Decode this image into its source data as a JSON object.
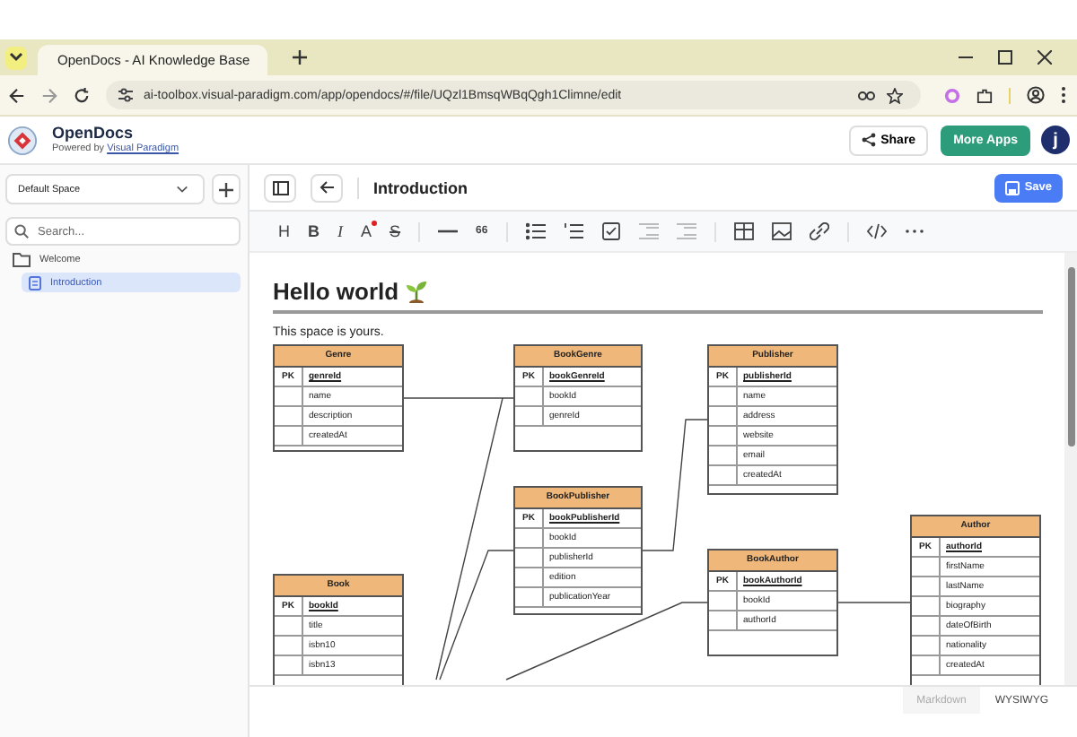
{
  "browser": {
    "tab_title": "OpenDocs - AI Knowledge Base",
    "url": "ai-toolbox.visual-paradigm.com/app/opendocs/#/file/UQzl1BmsqWBqQgh1Climne/edit"
  },
  "app": {
    "name": "OpenDocs",
    "powered_by": "Powered by",
    "powered_link": "Visual Paradigm",
    "share": "Share",
    "more_apps": "More Apps",
    "avatar": "j"
  },
  "sidebar": {
    "space": "Default Space",
    "search_placeholder": "Search...",
    "tree": [
      {
        "label": "Welcome",
        "selected": false,
        "children": [
          {
            "label": "Introduction",
            "selected": true
          }
        ]
      }
    ]
  },
  "editor": {
    "title": "Introduction",
    "save": "Save",
    "toolbar": [
      {
        "kind": "heading",
        "label": "H"
      },
      {
        "kind": "bold",
        "label": "B"
      },
      {
        "kind": "italic",
        "label": "I"
      },
      {
        "kind": "color",
        "label": "A"
      },
      {
        "kind": "strike",
        "label": "S"
      },
      {
        "kind": "divider"
      },
      {
        "kind": "rule"
      },
      {
        "kind": "quote",
        "label": "66"
      },
      {
        "kind": "divider"
      },
      {
        "kind": "bullets"
      },
      {
        "kind": "numbers"
      },
      {
        "kind": "task"
      },
      {
        "kind": "outdent"
      },
      {
        "kind": "indent"
      },
      {
        "kind": "divider"
      },
      {
        "kind": "table"
      },
      {
        "kind": "image"
      },
      {
        "kind": "link"
      },
      {
        "kind": "divider"
      },
      {
        "kind": "code"
      },
      {
        "kind": "more"
      }
    ],
    "heading": "Hello world",
    "paragraph": "This space is yours.",
    "entities": [
      {
        "name": "Genre",
        "fields": [
          {
            "key": "PK",
            "name": "genreId"
          },
          {
            "name": "name"
          },
          {
            "name": "description"
          },
          {
            "name": "createdAt"
          }
        ]
      },
      {
        "name": "BookGenre",
        "fields": [
          {
            "key": "PK",
            "name": "bookGenreId"
          },
          {
            "name": "bookId"
          },
          {
            "name": "genreId"
          }
        ]
      },
      {
        "name": "Publisher",
        "fields": [
          {
            "key": "PK",
            "name": "publisherId"
          },
          {
            "name": "name"
          },
          {
            "name": "address"
          },
          {
            "name": "website"
          },
          {
            "name": "email"
          },
          {
            "name": "createdAt"
          }
        ]
      },
      {
        "name": "BookPublisher",
        "fields": [
          {
            "key": "PK",
            "name": "bookPublisherId"
          },
          {
            "name": "bookId"
          },
          {
            "name": "publisherId"
          },
          {
            "name": "edition"
          },
          {
            "name": "publicationYear"
          }
        ]
      },
      {
        "name": "Book",
        "fields": [
          {
            "key": "PK",
            "name": "bookId"
          },
          {
            "name": "title"
          },
          {
            "name": "isbn10"
          },
          {
            "name": "isbn13"
          }
        ]
      },
      {
        "name": "BookAuthor",
        "fields": [
          {
            "key": "PK",
            "name": "bookAuthorId"
          },
          {
            "name": "bookId"
          },
          {
            "name": "authorId"
          }
        ]
      },
      {
        "name": "Author",
        "fields": [
          {
            "key": "PK",
            "name": "authorId"
          },
          {
            "name": "firstName"
          },
          {
            "name": "lastName"
          },
          {
            "name": "biography"
          },
          {
            "name": "dateOfBirth"
          },
          {
            "name": "nationality"
          },
          {
            "name": "createdAt"
          }
        ]
      }
    ],
    "modes": [
      {
        "label": "Markdown",
        "selected": false
      },
      {
        "label": "WYSIWYG",
        "selected": true
      }
    ]
  }
}
